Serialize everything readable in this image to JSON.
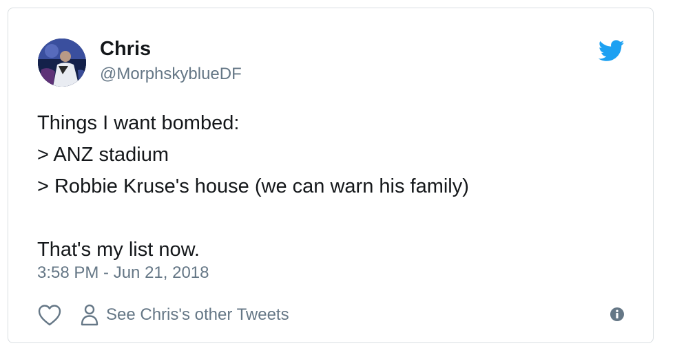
{
  "tweet": {
    "author_name": "Chris",
    "author_handle": "@MorphskyblueDF",
    "lines": [
      "Things I want bombed:",
      "> ANZ stadium",
      "> Robbie Kruse's house (we can warn his family)",
      "",
      "That's my list now."
    ],
    "timestamp": "3:58 PM - Jun 21, 2018",
    "see_other_label": "See Chris's other Tweets"
  },
  "icons": {
    "brand": "twitter-bird-icon",
    "like": "heart-icon",
    "profile": "person-icon",
    "info": "info-icon"
  },
  "colors": {
    "twitter_blue": "#1da1f2",
    "secondary_text": "#657786",
    "primary_text": "#14171a",
    "border": "#d8dde1"
  }
}
